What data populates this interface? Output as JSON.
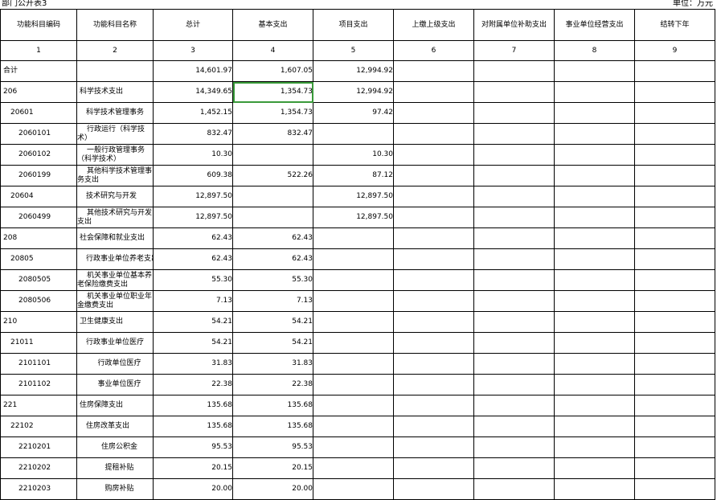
{
  "header": {
    "doc_label": "部门公开表3",
    "unit_label": "单位：万元"
  },
  "columns": [
    "功能科目编码",
    "功能科目名称",
    "总计",
    "基本支出",
    "项目支出",
    "上缴上级支出",
    "对附属单位补助支出",
    "事业单位经营支出",
    "结转下年"
  ],
  "column_numbers": [
    "1",
    "2",
    "3",
    "4",
    "5",
    "6",
    "7",
    "8",
    "9"
  ],
  "rows": [
    {
      "code": "合计",
      "name": "",
      "total": "14,601.97",
      "basic": "1,607.05",
      "project": "12,994.92",
      "level": 1
    },
    {
      "code": "206",
      "name": "科学技术支出",
      "total": "14,349.65",
      "basic": "1,354.73",
      "project": "12,994.92",
      "level": 1
    },
    {
      "code": "20601",
      "name": "科学技术管理事务",
      "total": "1,452.15",
      "basic": "1,354.73",
      "project": "97.42",
      "level": 2
    },
    {
      "code": "2060101",
      "name": "行政运行（科学技术）",
      "total": "832.47",
      "basic": "832.47",
      "project": "",
      "level": 3
    },
    {
      "code": "2060102",
      "name": "一般行政管理事务（科学技术）",
      "total": "10.30",
      "basic": "",
      "project": "10.30",
      "level": 3
    },
    {
      "code": "2060199",
      "name": "其他科学技术管理事务支出",
      "total": "609.38",
      "basic": "522.26",
      "project": "87.12",
      "level": 3
    },
    {
      "code": "20604",
      "name": "技术研究与开发",
      "total": "12,897.50",
      "basic": "",
      "project": "12,897.50",
      "level": 2
    },
    {
      "code": "2060499",
      "name": "其他技术研究与开发支出",
      "total": "12,897.50",
      "basic": "",
      "project": "12,897.50",
      "level": 3
    },
    {
      "code": "208",
      "name": "社会保障和就业支出",
      "total": "62.43",
      "basic": "62.43",
      "project": "",
      "level": 1
    },
    {
      "code": "20805",
      "name": "行政事业单位养老支出",
      "total": "62.43",
      "basic": "62.43",
      "project": "",
      "level": 2
    },
    {
      "code": "2080505",
      "name": "机关事业单位基本养老保险缴费支出",
      "total": "55.30",
      "basic": "55.30",
      "project": "",
      "level": 3
    },
    {
      "code": "2080506",
      "name": "机关事业单位职业年金缴费支出",
      "total": "7.13",
      "basic": "7.13",
      "project": "",
      "level": 3
    },
    {
      "code": "210",
      "name": "卫生健康支出",
      "total": "54.21",
      "basic": "54.21",
      "project": "",
      "level": 1
    },
    {
      "code": "21011",
      "name": "行政事业单位医疗",
      "total": "54.21",
      "basic": "54.21",
      "project": "",
      "level": 2
    },
    {
      "code": "2101101",
      "name": "行政单位医疗",
      "total": "31.83",
      "basic": "31.83",
      "project": "",
      "level": 3
    },
    {
      "code": "2101102",
      "name": "事业单位医疗",
      "total": "22.38",
      "basic": "22.38",
      "project": "",
      "level": 3
    },
    {
      "code": "221",
      "name": "住房保障支出",
      "total": "135.68",
      "basic": "135.68",
      "project": "",
      "level": 1
    },
    {
      "code": "22102",
      "name": "住房改革支出",
      "total": "135.68",
      "basic": "135.68",
      "project": "",
      "level": 2
    },
    {
      "code": "2210201",
      "name": "住房公积金",
      "total": "95.53",
      "basic": "95.53",
      "project": "",
      "level": 3
    },
    {
      "code": "2210202",
      "name": "提租补贴",
      "total": "20.15",
      "basic": "20.15",
      "project": "",
      "level": 3
    },
    {
      "code": "2210203",
      "name": "购房补贴",
      "total": "20.00",
      "basic": "20.00",
      "project": "",
      "level": 3
    }
  ],
  "selected_cell": {
    "row": 1,
    "col": "basic"
  },
  "colors": {
    "selection": "#3a9a3a",
    "grid": "#000000"
  }
}
